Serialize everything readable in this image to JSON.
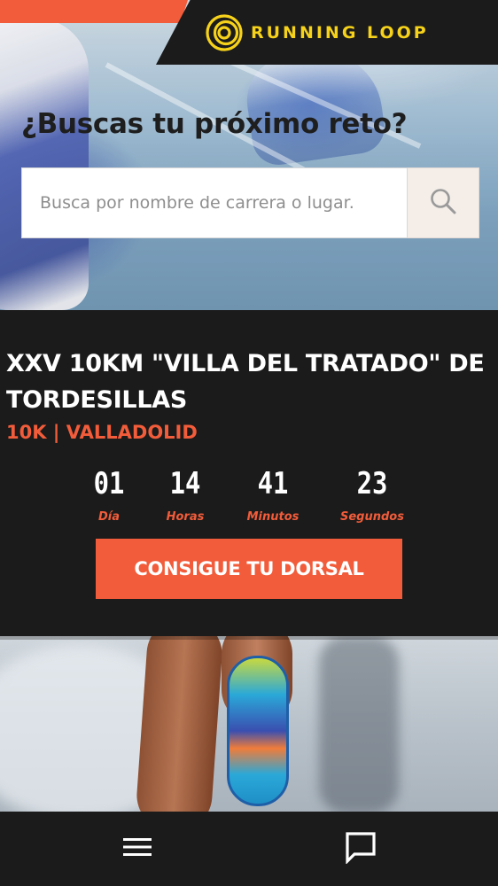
{
  "brand": {
    "name": "RUNNING LOOP",
    "logo_icon": "loop-logo-icon",
    "color": "#f6d21b"
  },
  "hero": {
    "title": "¿Buscas tu próximo reto?",
    "search": {
      "placeholder": "Busca por nombre de carrera o lugar.",
      "value": "",
      "button_icon": "search-icon"
    }
  },
  "event": {
    "title": "XXV 10KM \"VILLA DEL TRATADO\" DE TORDESILLAS",
    "subtitle": "10K | VALLADOLID",
    "countdown": [
      {
        "value": "01",
        "label": "Día"
      },
      {
        "value": "14",
        "label": "Horas"
      },
      {
        "value": "41",
        "label": "Minutos"
      },
      {
        "value": "23",
        "label": "Segundos"
      }
    ],
    "cta_label": "CONSIGUE TU DORSAL"
  },
  "bottom_nav": {
    "menu_icon": "hamburger-menu-icon",
    "chat_icon": "chat-icon"
  },
  "colors": {
    "accent": "#f25c3a",
    "dark": "#1b1b1b",
    "brand_yellow": "#f6d21b"
  }
}
